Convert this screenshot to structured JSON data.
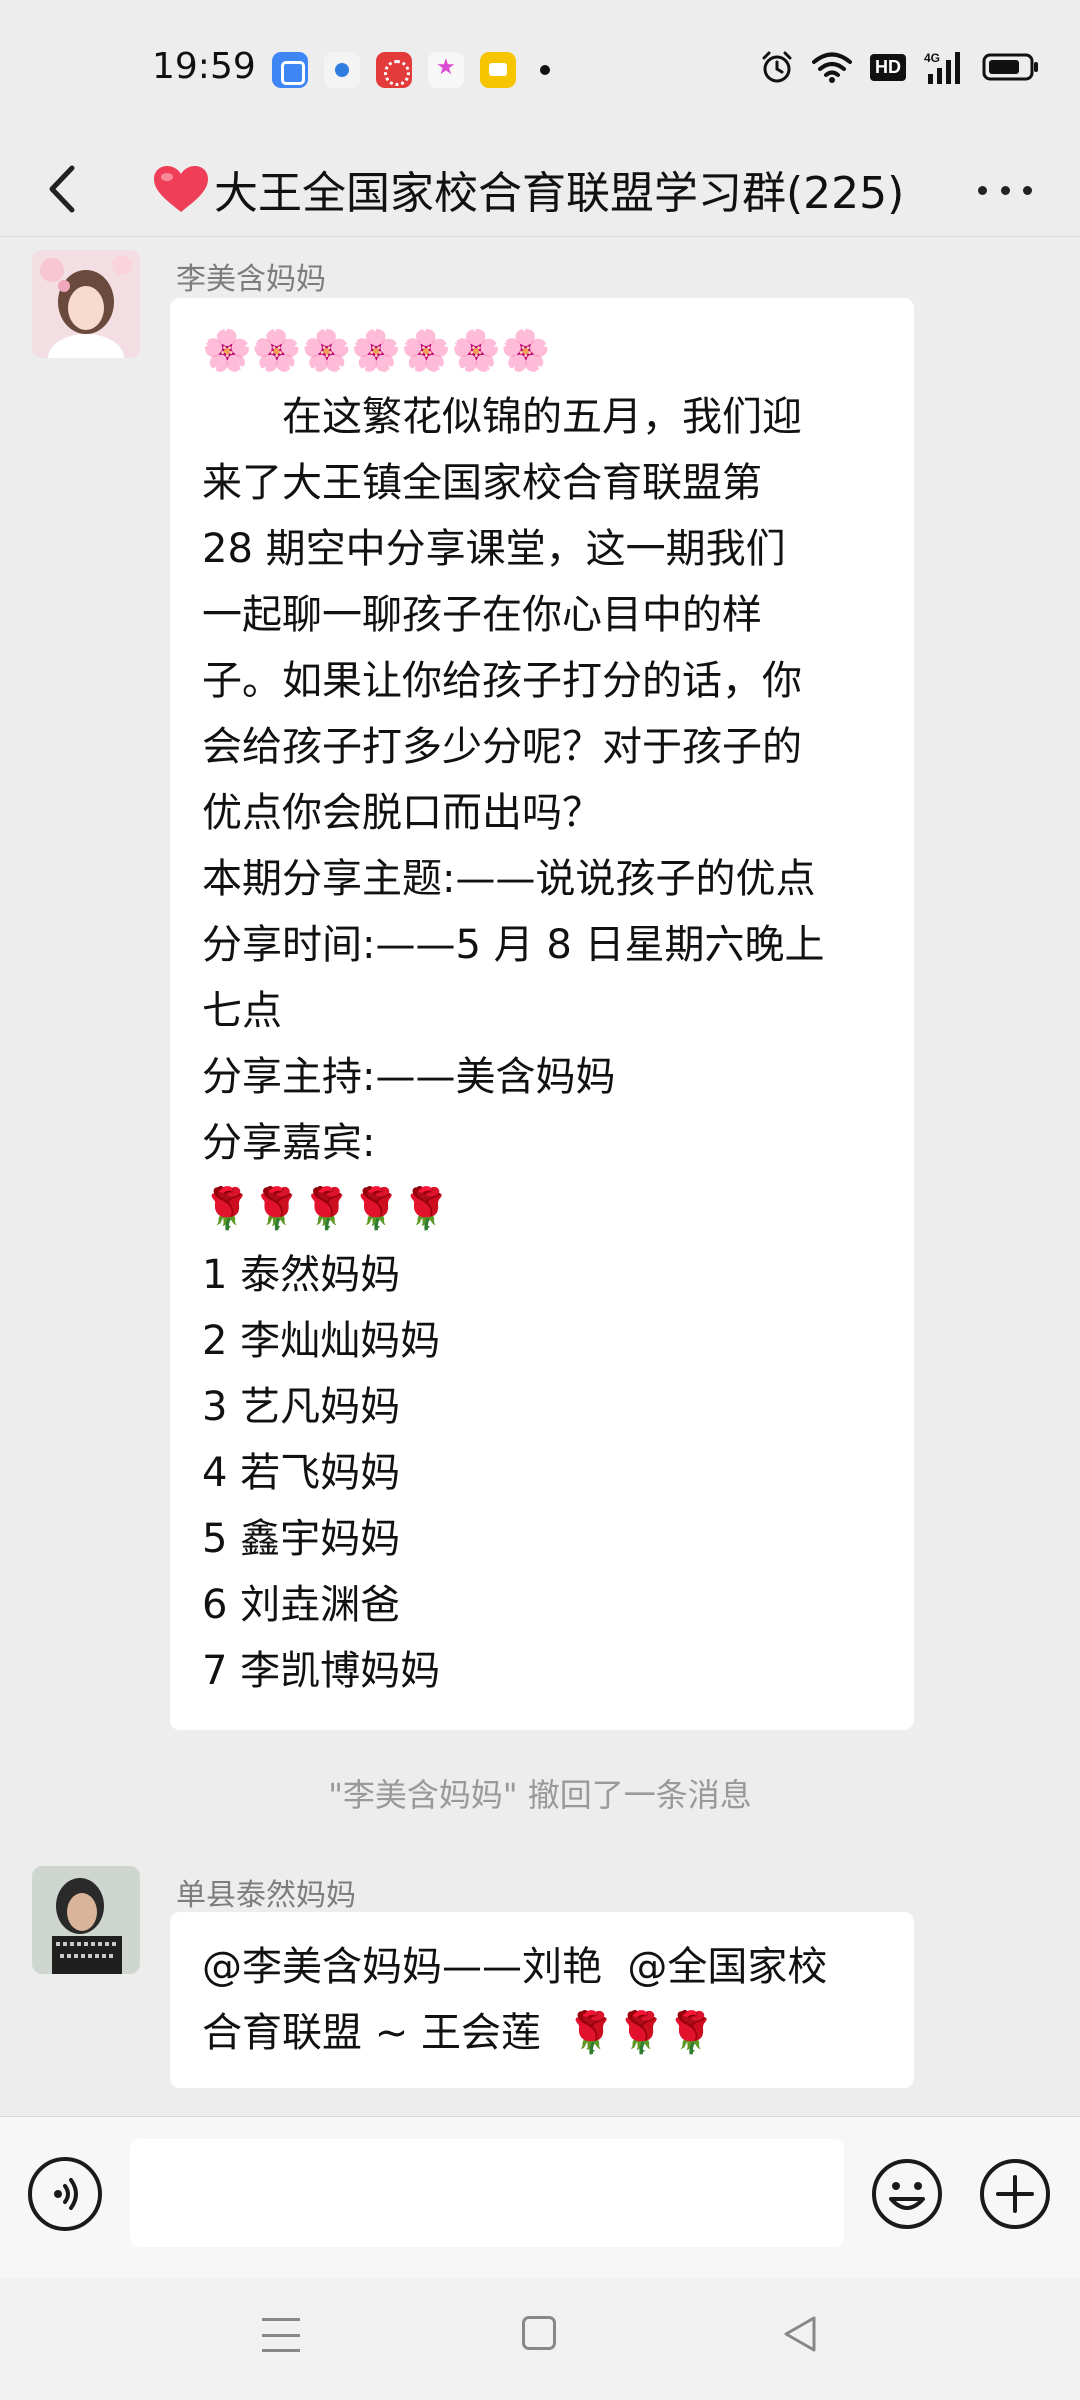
{
  "status_bar": {
    "time": "19:59",
    "network": "4G",
    "hd": "HD"
  },
  "chat": {
    "title": "大王全国家校合育联盟学习群(225)",
    "title_icon": "red-heart-emoji"
  },
  "messages": [
    {
      "sender": "李美含妈妈",
      "lines": [
        "🌸🌸🌸🌸🌸🌸🌸",
        "　　在这繁花似锦的五月，我们迎",
        "来了大王镇全国家校合育联盟第",
        "28 期空中分享课堂，这一期我们",
        "一起聊一聊孩子在你心目中的样",
        "子。如果让你给孩子打分的话，你",
        "会给孩子打多少分呢？对于孩子的",
        "优点你会脱口而出吗？",
        "本期分享主题:——说说孩子的优点",
        "分享时间:——5 月 8 日星期六晚上",
        "七点",
        "分享主持:——美含妈妈",
        "分享嘉宾:",
        "🌹🌹🌹🌹🌹",
        "1 泰然妈妈",
        "2 李灿灿妈妈",
        "3 艺凡妈妈",
        "4 若飞妈妈",
        "5 鑫宇妈妈",
        "6 刘垚渊爸",
        "7 李凯博妈妈"
      ]
    },
    {
      "sender": "单县泰然妈妈",
      "lines": [
        "@李美含妈妈——刘艳  @全国家校",
        "合育联盟 ~ 王会莲  🌹🌹🌹"
      ]
    }
  ],
  "system_notice": "\"李美含妈妈\" 撤回了一条消息",
  "input": {
    "value": "",
    "placeholder": ""
  },
  "colors": {
    "background": "#ededed",
    "bubble": "#ffffff",
    "sender": "#7d7d7d",
    "notice": "#999999"
  }
}
